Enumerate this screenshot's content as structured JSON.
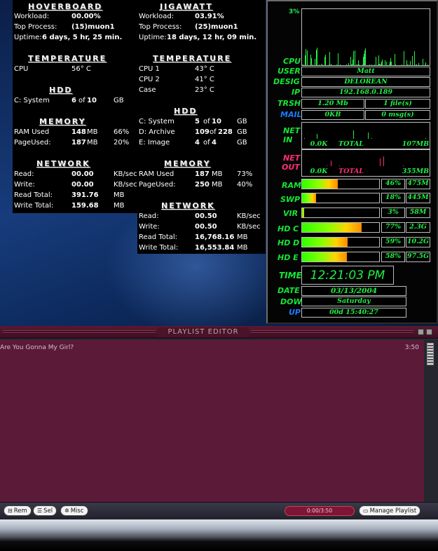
{
  "hoverboard": {
    "title": "HOVERBOARD",
    "workload_label": "Workload:",
    "workload": "00.00%",
    "top_label": "Top Process:",
    "top": "(15)muon1",
    "uptime_label": "Uptime:",
    "uptime": "6 days, 5 hr, 25 min.",
    "temp_title": "TEMPERATURE",
    "temps": [
      {
        "label": "CPU",
        "value": "56° C"
      }
    ],
    "hdd_title": "HDD",
    "hdd": [
      {
        "label": "C: System",
        "used": "6",
        "of": "of",
        "total": "10",
        "unit": "GB"
      }
    ],
    "mem_title": "MEMORY",
    "mem": [
      {
        "label": "RAM Used",
        "value": "148",
        "unit": "MB",
        "pct": "66%"
      },
      {
        "label": "PageUsed:",
        "value": "187",
        "unit": "MB",
        "pct": "20%"
      }
    ],
    "net_title": "NETWORK",
    "net": [
      {
        "label": "Read:",
        "value": "00.00",
        "unit": "KB/sec"
      },
      {
        "label": "Write:",
        "value": "00.00",
        "unit": "KB/sec"
      },
      {
        "label": "Read Total:",
        "value": "391.76",
        "unit": "MB"
      },
      {
        "label": "Write Total:",
        "value": "159.68",
        "unit": "MB"
      }
    ]
  },
  "jigawatt": {
    "title": "JIGAWATT",
    "workload_label": "Workload:",
    "workload": "03.91%",
    "top_label": "Top Process:",
    "top": "(25)muon1",
    "uptime_label": "Uptime:",
    "uptime": "18 days, 12 hr, 09 min.",
    "temp_title": "TEMPERATURE",
    "temps": [
      {
        "label": "CPU 1",
        "value": "43° C"
      },
      {
        "label": "CPU 2",
        "value": "41° C"
      },
      {
        "label": "Case",
        "value": "23° C"
      }
    ],
    "hdd_title": "HDD",
    "hdd": [
      {
        "label": "C: System",
        "used": "5",
        "of": "of",
        "total": "10",
        "unit": "GB"
      },
      {
        "label": "D: Archive",
        "used": "109",
        "of": "of",
        "total": "228",
        "unit": "GB"
      },
      {
        "label": "E: Image",
        "used": "4",
        "of": "of",
        "total": "4",
        "unit": "GB"
      }
    ],
    "mem_title": "MEMORY",
    "mem": [
      {
        "label": "RAM Used",
        "value": "187",
        "unit": "MB",
        "pct": "73%"
      },
      {
        "label": "PageUsed:",
        "value": "250",
        "unit": "MB",
        "pct": "40%"
      }
    ],
    "net_title": "NETWORK",
    "net": [
      {
        "label": "Read:",
        "value": "00.50",
        "unit": "KB/sec"
      },
      {
        "label": "Write:",
        "value": "00.50",
        "unit": "KB/sec"
      },
      {
        "label": "Read Total:",
        "value": "16,768.16",
        "unit": "MB"
      },
      {
        "label": "Write Total:",
        "value": "16,553.84",
        "unit": "MB"
      }
    ]
  },
  "sysmeter": {
    "cpu_pct": "3%",
    "cpu_label": "CPU",
    "user_label": "USER",
    "user": "Matt",
    "desig_label": "DESIG",
    "desig": "DELOREAN",
    "ip_label": "IP",
    "ip": "192.168.0.189",
    "trsh_label": "TRSH",
    "trsh_size": "1.20 Mb",
    "trsh_files": "1 file(s)",
    "mail_label": "MAIL",
    "mail_size": "0KB",
    "mail_msgs": "0 msg(s)",
    "netin_label_1": "NET",
    "netin_label_2": "IN",
    "netin_rate": "0.0K",
    "netin_total_label": "TOTAL",
    "netin_total": "107MB",
    "netout_label_1": "NET",
    "netout_label_2": "OUT",
    "netout_rate": "0.0K",
    "netout_total_label": "TOTAL",
    "netout_total": "355MB",
    "meters": [
      {
        "label": "RAM",
        "pct_text": "46%",
        "size": "475M",
        "fraction": 0.46
      },
      {
        "label": "SWP",
        "pct_text": "18%",
        "size": "445M",
        "fraction": 0.18
      },
      {
        "label": "VIR",
        "pct_text": "3%",
        "size": "58M",
        "fraction": 0.03
      },
      {
        "label": "HD C",
        "pct_text": "77%",
        "size": "2.3G",
        "fraction": 0.77
      },
      {
        "label": "HD D",
        "pct_text": "59%",
        "size": "10.2G",
        "fraction": 0.59
      },
      {
        "label": "HD E",
        "pct_text": "58%",
        "size": "97.5G",
        "fraction": 0.58
      }
    ],
    "time_label": "TIME",
    "time": "12:21:03 PM",
    "date_label": "DATE",
    "date": "03/13/2004",
    "dow_label": "DOW",
    "dow": "Saturday",
    "up_label": "UP",
    "up": "00d 15:40:27"
  },
  "playlist": {
    "title": "PLAYLIST EDITOR",
    "items": [
      {
        "title": "Are You Gonna My Girl?",
        "duration": "3:50"
      }
    ],
    "rem_label": "Rem",
    "sel_label": "Sel",
    "misc_label": "Misc",
    "time_display": "0:00/3:50",
    "manage_label": "Manage Playlist"
  },
  "colors": {
    "green": "#22ee44",
    "pink": "#ff2d78",
    "blue": "#1b7bff",
    "playlist_bg": "#5a1a38"
  }
}
